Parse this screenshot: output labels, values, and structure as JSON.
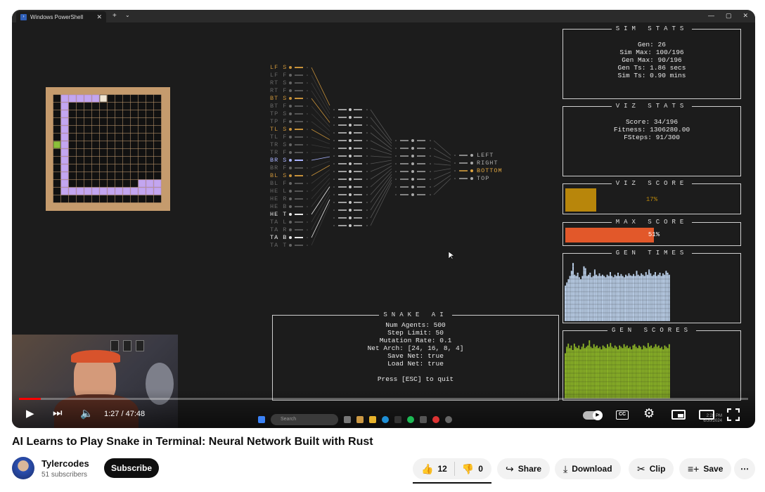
{
  "window": {
    "tab_title": "Windows PowerShell",
    "add_tab": "+",
    "dropdown": "⌄",
    "close": "✕",
    "ctrls": [
      "—",
      "▢",
      "✕"
    ]
  },
  "sim_stats": {
    "title": "SIM STATS",
    "lines": [
      "Gen: 26",
      "Sim Max: 100/196",
      "Gen Max: 90/196",
      "Gen Ts: 1.86 secs",
      "Sim Ts: 0.90 mins"
    ]
  },
  "viz_stats": {
    "title": "VIZ STATS",
    "lines": [
      "Score: 34/196",
      "Fitness: 1306280.00",
      "FSteps: 91/300"
    ]
  },
  "viz_score": {
    "title": "VIZ SCORE",
    "label": "17%",
    "fraction": 0.17,
    "color": "#b8860b"
  },
  "max_score": {
    "title": "MAX SCORE",
    "label": "51%",
    "fraction": 0.51,
    "color": "#e2582a"
  },
  "gen_times": {
    "title": "GEN TIMES",
    "color": "#b9cde6",
    "values": [
      0.55,
      0.6,
      0.65,
      0.7,
      0.78,
      0.9,
      0.72,
      0.7,
      0.75,
      0.68,
      0.65,
      0.7,
      0.85,
      0.82,
      0.7,
      0.72,
      0.75,
      0.68,
      0.7,
      0.8,
      0.72,
      0.7,
      0.74,
      0.7,
      0.72,
      0.7,
      0.68,
      0.72,
      0.7,
      0.76,
      0.7,
      0.68,
      0.72,
      0.7,
      0.75,
      0.7,
      0.73,
      0.7,
      0.68,
      0.72,
      0.7,
      0.74,
      0.71,
      0.7,
      0.73,
      0.7,
      0.78,
      0.72,
      0.7,
      0.74,
      0.72,
      0.7,
      0.76,
      0.72,
      0.8,
      0.74,
      0.7,
      0.72,
      0.76,
      0.7,
      0.72,
      0.75,
      0.7,
      0.74,
      0.72,
      0.78,
      0.75,
      0.72
    ]
  },
  "gen_scores": {
    "title": "GEN SCORES",
    "color": "#8bb327",
    "values": [
      0.7,
      0.8,
      0.85,
      0.78,
      0.82,
      0.75,
      0.85,
      0.8,
      0.78,
      0.82,
      0.76,
      0.8,
      0.85,
      0.78,
      0.8,
      0.82,
      0.9,
      0.8,
      0.78,
      0.84,
      0.8,
      0.82,
      0.78,
      0.8,
      0.76,
      0.82,
      0.8,
      0.78,
      0.84,
      0.8,
      0.86,
      0.8,
      0.78,
      0.82,
      0.8,
      0.76,
      0.82,
      0.8,
      0.78,
      0.84,
      0.8,
      0.82,
      0.78,
      0.8,
      0.76,
      0.82,
      0.84,
      0.8,
      0.78,
      0.82,
      0.8,
      0.76,
      0.82,
      0.8,
      0.78,
      0.86,
      0.8,
      0.82,
      0.78,
      0.8,
      0.84,
      0.8,
      0.82,
      0.78,
      0.8,
      0.76,
      0.82,
      0.8,
      0.78,
      0.84
    ]
  },
  "snake_ai": {
    "title": "SNAKE AI",
    "lines": [
      "Num Agents: 500",
      "Step Limit: 50",
      "Mutation Rate: 0.1",
      "Net Arch: [24, 16, 8, 4]",
      "Save Net: true",
      "Load Net: true"
    ],
    "quit": "Press [ESC] to quit"
  },
  "inputs": [
    {
      "label": "LF S",
      "color": "#c8923a",
      "active": true
    },
    {
      "label": "LF F",
      "color": "#666"
    },
    {
      "label": "RT S",
      "color": "#666"
    },
    {
      "label": "RT F",
      "color": "#666"
    },
    {
      "label": "BT S",
      "color": "#c8923a",
      "active": true
    },
    {
      "label": "BT F",
      "color": "#666"
    },
    {
      "label": "TP S",
      "color": "#666"
    },
    {
      "label": "TP F",
      "color": "#666"
    },
    {
      "label": "TL S",
      "color": "#c8923a",
      "active": true
    },
    {
      "label": "TL F",
      "color": "#666"
    },
    {
      "label": "TR S",
      "color": "#666"
    },
    {
      "label": "TR F",
      "color": "#666"
    },
    {
      "label": "BR S",
      "color": "#aab4ff",
      "active": true
    },
    {
      "label": "BR F",
      "color": "#666"
    },
    {
      "label": "BL S",
      "color": "#c8923a",
      "active": true
    },
    {
      "label": "BL F",
      "color": "#666"
    },
    {
      "label": "HE L",
      "color": "#666"
    },
    {
      "label": "HE R",
      "color": "#666"
    },
    {
      "label": "HE B",
      "color": "#666"
    },
    {
      "label": "HE T",
      "color": "#e8e8e8",
      "active": true
    },
    {
      "label": "TA L",
      "color": "#666"
    },
    {
      "label": "TA R",
      "color": "#666"
    },
    {
      "label": "TA B",
      "color": "#e8e8e8",
      "active": true
    },
    {
      "label": "TA T",
      "color": "#666"
    }
  ],
  "outputs": [
    {
      "label": "LEFT",
      "color": "#aaa"
    },
    {
      "label": "RIGHT",
      "color": "#aaa"
    },
    {
      "label": "BOTTOM",
      "color": "#e0a640"
    },
    {
      "label": "TOP",
      "color": "#aaa"
    }
  ],
  "player": {
    "time": "1:27 / 47:48",
    "progress": 0.03
  },
  "taskbar": {
    "search": "Search",
    "clock": "2:28 PM",
    "date": "6/30/2024"
  },
  "video": {
    "title": "AI Learns to Play Snake in Terminal: Neural Network Built with Rust",
    "channel": "Tylercodes",
    "subscribers": "51 subscribers",
    "subscribe": "Subscribe",
    "likes": "12",
    "dislikes": "0",
    "share": "Share",
    "download": "Download",
    "clip": "Clip",
    "save": "Save",
    "more": "⋯"
  }
}
